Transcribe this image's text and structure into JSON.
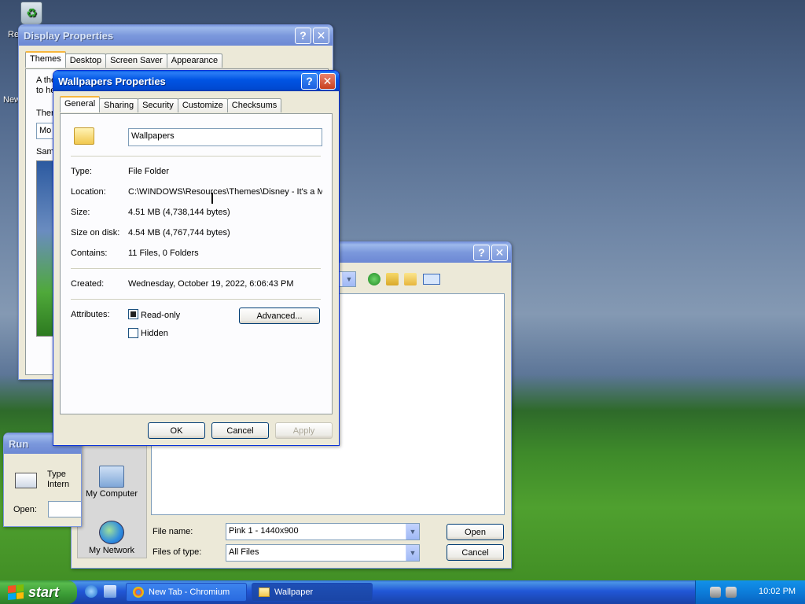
{
  "desktop": {
    "icons": [
      {
        "label": "Re",
        "icon": "recycle-bin-icon"
      },
      {
        "label": "New"
      }
    ]
  },
  "display_props": {
    "title": "Display Properties",
    "tabs": [
      "Themes",
      "Desktop",
      "Screen Saver",
      "Appearance"
    ],
    "text_line1": "A the",
    "text_line2": "to he",
    "theme_label": "Ther",
    "theme_value": "Mo",
    "sample_label": "Sam"
  },
  "wallpaper_props": {
    "title": "Wallpapers Properties",
    "tabs": [
      "General",
      "Sharing",
      "Security",
      "Customize",
      "Checksums"
    ],
    "name": "Wallpapers",
    "type_label": "Type:",
    "type_value": "File Folder",
    "location_label": "Location:",
    "location_value": "C:\\WINDOWS\\Resources\\Themes\\Disney - It's a M",
    "size_label": "Size:",
    "size_value": "4.51 MB (4,738,144 bytes)",
    "size_disk_label": "Size on disk:",
    "size_disk_value": "4.54 MB (4,767,744 bytes)",
    "contains_label": "Contains:",
    "contains_value": "11 Files, 0 Folders",
    "created_label": "Created:",
    "created_value": "Wednesday, October 19, 2022, 6:06:43 PM",
    "attributes_label": "Attributes:",
    "readonly_label": "Read-only",
    "readonly_checked": true,
    "hidden_label": "Hidden",
    "hidden_checked": false,
    "advanced_button": "Advanced...",
    "ok_button": "OK",
    "cancel_button": "Cancel",
    "apply_button": "Apply"
  },
  "open_dialog": {
    "places": [
      "My Computer",
      "My Network"
    ],
    "filename_label": "File name:",
    "filename_value": "Pink 1 - 1440x900",
    "filetype_label": "Files of type:",
    "filetype_value": "All Files",
    "open_button": "Open",
    "cancel_button": "Cancel"
  },
  "run_dialog": {
    "title": "Run",
    "text_line1": "Type",
    "text_line2": "Intern",
    "open_label": "Open:"
  },
  "taskbar": {
    "start_label": "start",
    "tasks": [
      {
        "label": "New Tab - Chromium",
        "icon": "chromium-icon"
      },
      {
        "label": "Wallpaper",
        "icon": "folder-icon"
      }
    ],
    "clock": "10:02 PM"
  }
}
